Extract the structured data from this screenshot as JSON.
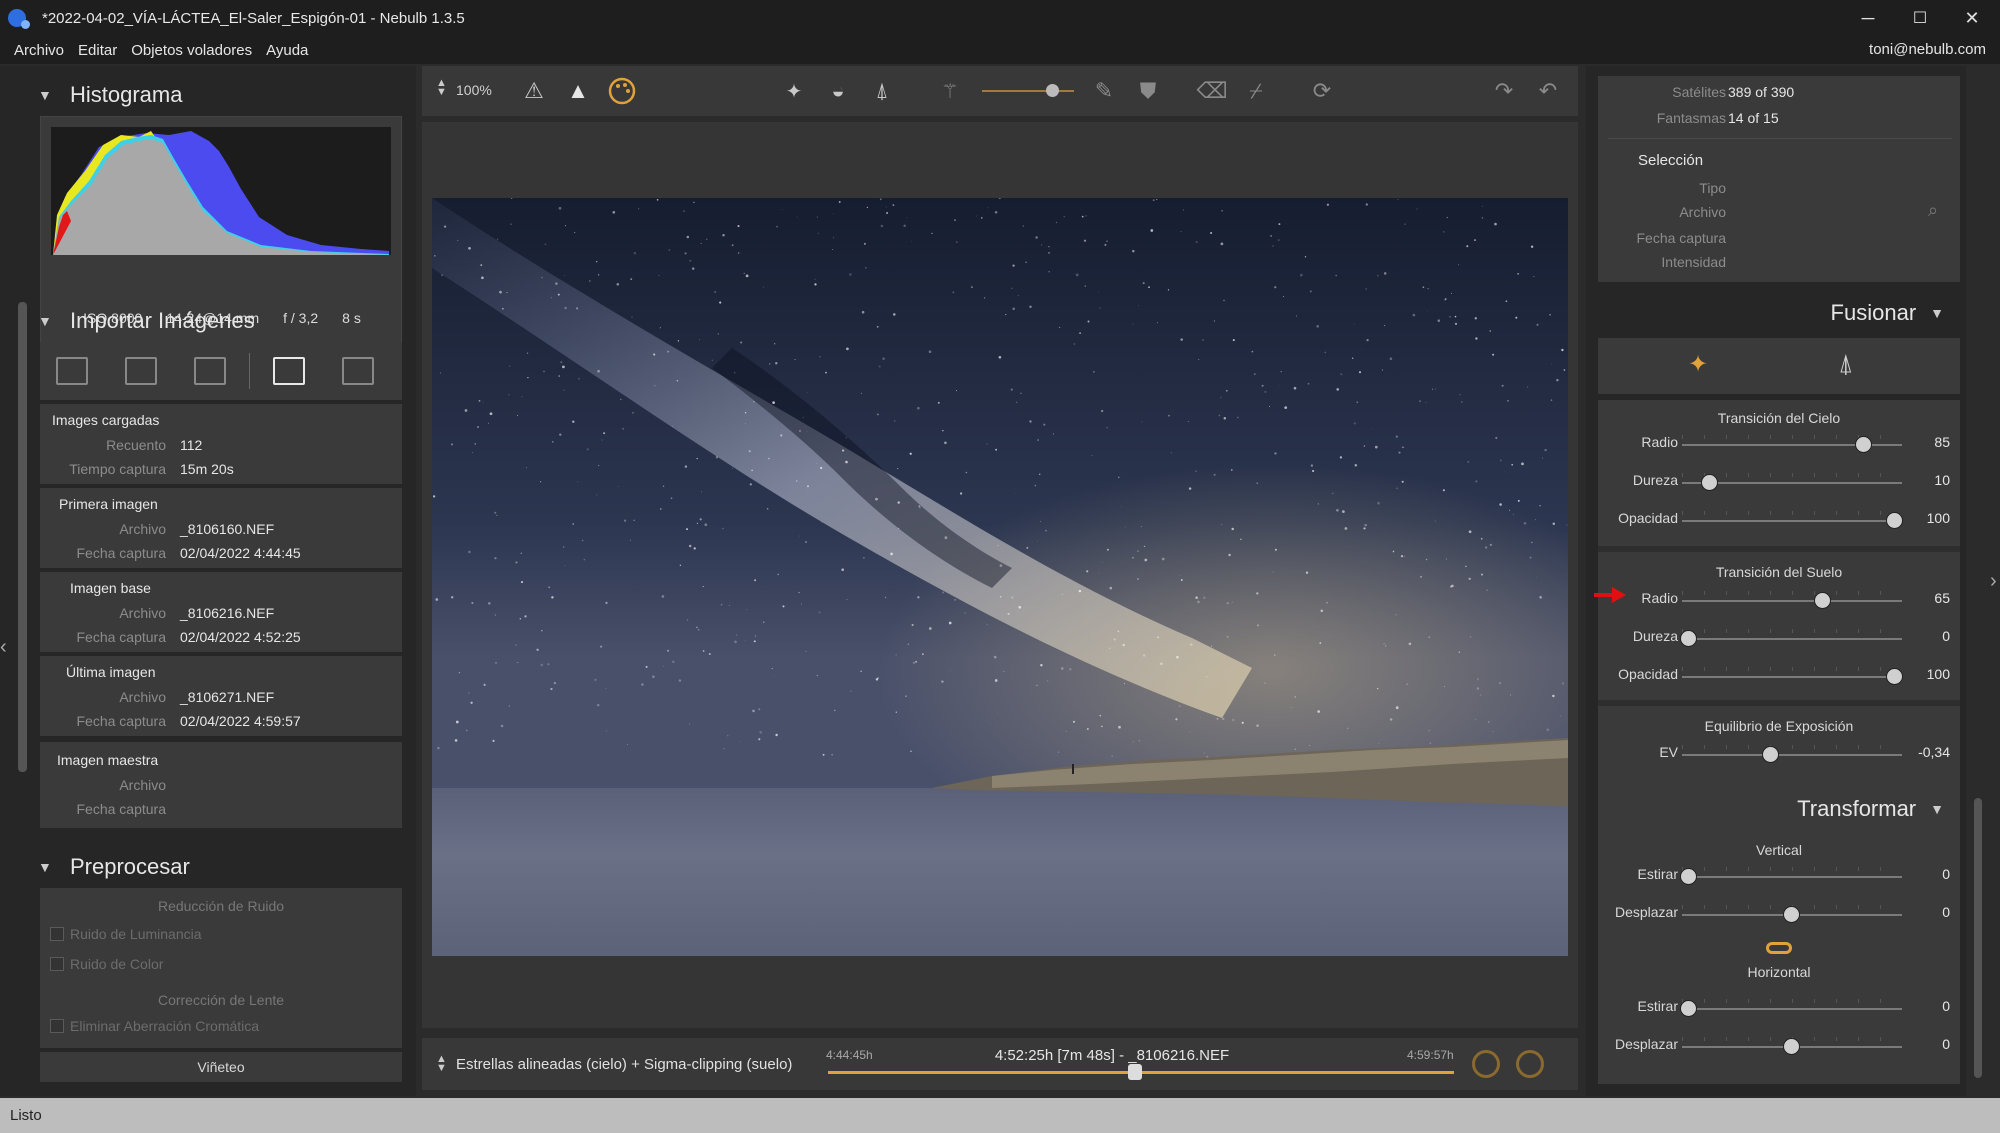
{
  "window": {
    "title": "*2022-04-02_VÍA-LÁCTEA_El-Saler_Espigón-01 - Nebulb 1.3.5",
    "minimize": "─",
    "maximize": "☐",
    "close": "✕"
  },
  "menu": {
    "items": [
      "Archivo",
      "Editar",
      "Objetos voladores",
      "Ayuda"
    ],
    "user": "toni@nebulb.com"
  },
  "histogram": {
    "title": "Histograma",
    "iso": "ISO 8000",
    "lens": "14-24@14 mm",
    "aperture": "f / 3,2",
    "exposure": "8 s"
  },
  "import": {
    "title": "Importar Imágenes",
    "loaded": {
      "title": "Images cargadas",
      "count_label": "Recuento",
      "count": "112",
      "time_label": "Tiempo captura",
      "time": "15m 20s"
    },
    "first": {
      "title": "Primera imagen",
      "file_label": "Archivo",
      "file": "_8106160.NEF",
      "date_label": "Fecha captura",
      "date": "02/04/2022 4:44:45"
    },
    "base": {
      "title": "Imagen base",
      "file_label": "Archivo",
      "file": "_8106216.NEF",
      "date_label": "Fecha captura",
      "date": "02/04/2022 4:52:25"
    },
    "last": {
      "title": "Última imagen",
      "file_label": "Archivo",
      "file": "_8106271.NEF",
      "date_label": "Fecha captura",
      "date": "02/04/2022 4:59:57"
    },
    "master": {
      "title": "Imagen maestra",
      "file_label": "Archivo",
      "date_label": "Fecha captura"
    }
  },
  "preprocess": {
    "title": "Preprocesar",
    "noise_title": "Reducción de Ruido",
    "luminance": "Ruido de Luminancia",
    "color": "Ruido de Color",
    "lens_title": "Corrección de Lente",
    "chromatic": "Eliminar Aberración Cromática",
    "vignette": "Viñeteo"
  },
  "toolbar": {
    "zoom": "100%"
  },
  "timeline": {
    "mode": "Estrellas alineadas (cielo) + Sigma-clipping (suelo)",
    "start": "4:44:45h",
    "current": "4:52:25h [7m 48s] - _8106216.NEF",
    "end": "4:59:57h",
    "position": 0.49
  },
  "selection_info": {
    "satellites_label": "Satélites",
    "satellites": "389 of 390",
    "ghosts_label": "Fantasmas",
    "ghosts": "14 of 15",
    "selection_title": "Selección",
    "type_label": "Tipo",
    "file_label": "Archivo",
    "date_label": "Fecha captura",
    "intensity_label": "Intensidad"
  },
  "merge": {
    "title": "Fusionar",
    "sky_title": "Transición del Cielo",
    "sky": [
      {
        "label": "Radio",
        "value": "85",
        "level": 0.85
      },
      {
        "label": "Dureza",
        "value": "10",
        "level": 0.1
      },
      {
        "label": "Opacidad",
        "value": "100",
        "level": 1.0
      }
    ],
    "ground_title": "Transición del Suelo",
    "ground": [
      {
        "label": "Radio",
        "value": "65",
        "level": 0.65
      },
      {
        "label": "Dureza",
        "value": "0",
        "level": 0.0
      },
      {
        "label": "Opacidad",
        "value": "100",
        "level": 1.0
      }
    ],
    "exposure_title": "Equilibrio de Exposición",
    "exposure": {
      "label": "EV",
      "value": "-0,34",
      "level": 0.4
    }
  },
  "transform": {
    "title": "Transformar",
    "vertical_title": "Vertical",
    "vertical": [
      {
        "label": "Estirar",
        "value": "0",
        "level": 0.0
      },
      {
        "label": "Desplazar",
        "value": "0",
        "level": 0.5
      }
    ],
    "horizontal_title": "Horizontal",
    "horizontal": [
      {
        "label": "Estirar",
        "value": "0",
        "level": 0.0
      },
      {
        "label": "Desplazar",
        "value": "0",
        "level": 0.5
      }
    ]
  },
  "status": {
    "text": "Listo"
  },
  "colors": {
    "accent": "#e0a23a",
    "arrow": "#e01010"
  }
}
